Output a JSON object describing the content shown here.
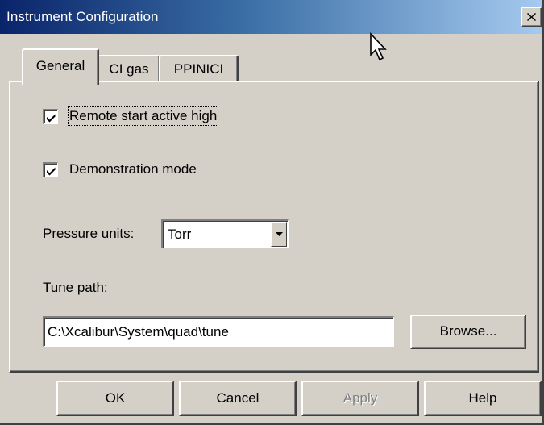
{
  "window": {
    "title": "Instrument Configuration",
    "close_icon": "close-icon"
  },
  "tabs": [
    {
      "label": "General",
      "active": true
    },
    {
      "label": "CI gas",
      "active": false
    },
    {
      "label": "PPINICI",
      "active": false
    }
  ],
  "general": {
    "remote_start": {
      "label": "Remote start active high",
      "checked": true
    },
    "demo_mode": {
      "label": "Demonstration mode",
      "checked": true
    },
    "pressure_units": {
      "label": "Pressure units:",
      "value": "Torr"
    },
    "tune_path": {
      "label": "Tune path:",
      "value": "C:\\Xcalibur\\System\\quad\\tune",
      "browse_label": "Browse..."
    }
  },
  "buttons": {
    "ok": "OK",
    "cancel": "Cancel",
    "apply": "Apply",
    "help": "Help"
  },
  "colors": {
    "title_start": "#0a246a",
    "title_end": "#a6caf0",
    "face": "#d4d0c8"
  }
}
